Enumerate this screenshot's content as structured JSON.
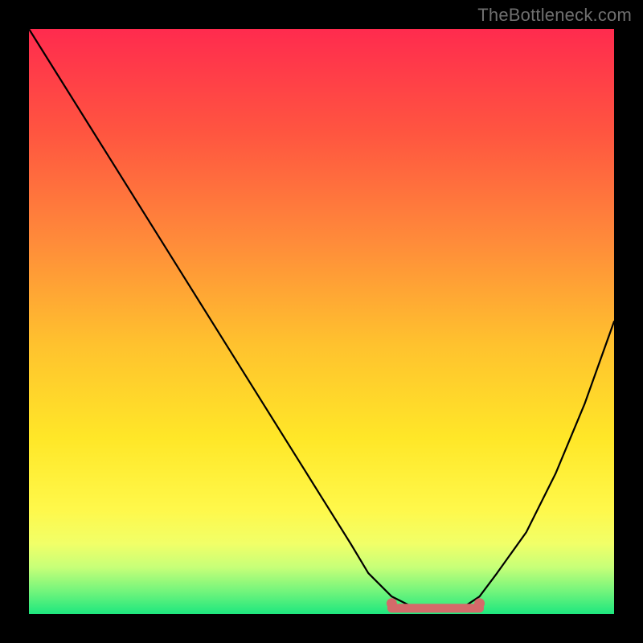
{
  "watermark": "TheBottleneck.com",
  "chart_data": {
    "type": "line",
    "title": "",
    "xlabel": "",
    "ylabel": "",
    "xlim": [
      0,
      100
    ],
    "ylim": [
      0,
      100
    ],
    "series": [
      {
        "name": "curve",
        "x": [
          0,
          5,
          10,
          15,
          20,
          25,
          30,
          35,
          40,
          45,
          50,
          55,
          58,
          62,
          66,
          70,
          74,
          77,
          80,
          85,
          90,
          95,
          100
        ],
        "values": [
          100,
          92,
          84,
          76,
          68,
          60,
          52,
          44,
          36,
          28,
          20,
          12,
          7,
          3,
          1,
          1,
          1,
          3,
          7,
          14,
          24,
          36,
          50
        ]
      }
    ],
    "flat_region": {
      "x_start": 62,
      "x_end": 77,
      "y": 1,
      "color": "#d46a6a"
    },
    "colors": {
      "curve": "#000000",
      "background_top": "#ff2b4e",
      "background_bottom": "#1de77e",
      "flat_marker": "#d46a6a"
    }
  }
}
